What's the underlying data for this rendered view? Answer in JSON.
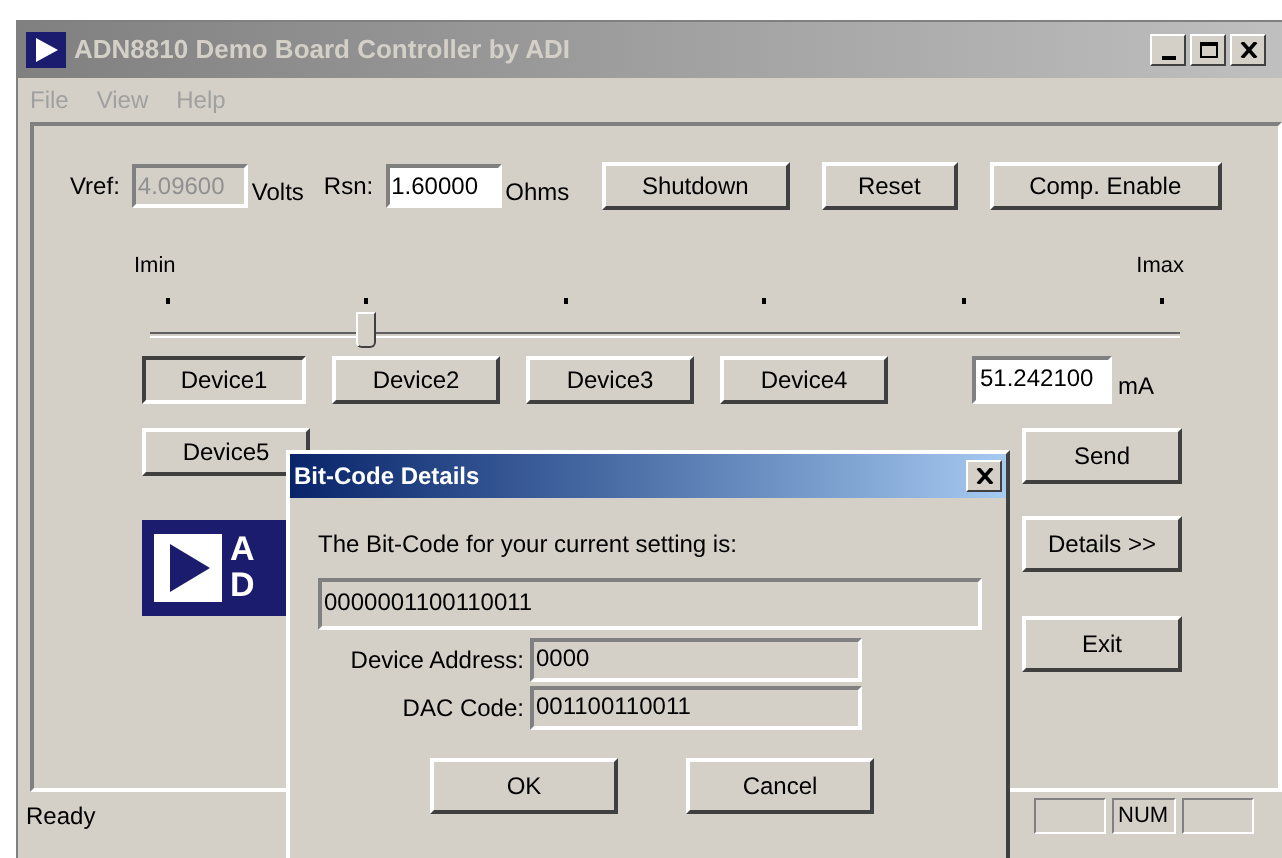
{
  "main_window": {
    "title": "ADN8810 Demo Board Controller by ADI",
    "active": false
  },
  "menu": [
    {
      "label": "File",
      "disabled": true
    },
    {
      "label": "View",
      "disabled": true
    },
    {
      "label": "Help",
      "disabled": true
    }
  ],
  "vref": {
    "label": "Vref:",
    "value": "4.09600",
    "unit": "Volts",
    "disabled": true
  },
  "rsn": {
    "label": "Rsn:",
    "value": "1.60000",
    "unit": "Ohms",
    "disabled": false
  },
  "top_buttons": [
    "Shutdown",
    "Reset",
    "Comp. Enable"
  ],
  "slider": {
    "min_label": "Imin",
    "max_label": "Imax",
    "level": 0.2
  },
  "devices": [
    {
      "label": "Device1",
      "selected": true
    },
    {
      "label": "Device2",
      "selected": false
    },
    {
      "label": "Device3",
      "selected": false
    },
    {
      "label": "Device4",
      "selected": false
    },
    {
      "label": "Device5",
      "selected": false
    }
  ],
  "current": {
    "value": "51.242100",
    "unit": "mA"
  },
  "side_buttons": [
    "Send",
    "Details >>",
    "Exit"
  ],
  "logo_text": [
    "A",
    "D"
  ],
  "status_bar": {
    "message": "Ready",
    "indicator": "NUM"
  },
  "dialog": {
    "title": "Bit-Code Details",
    "active": true,
    "prompt": "The Bit-Code for your current setting is:",
    "bit_code": "0000001100110011",
    "fields": [
      {
        "label": "Device Address:",
        "value": "0000"
      },
      {
        "label": "DAC Code:",
        "value": "001100110011"
      }
    ],
    "buttons": [
      "OK",
      "Cancel"
    ]
  }
}
